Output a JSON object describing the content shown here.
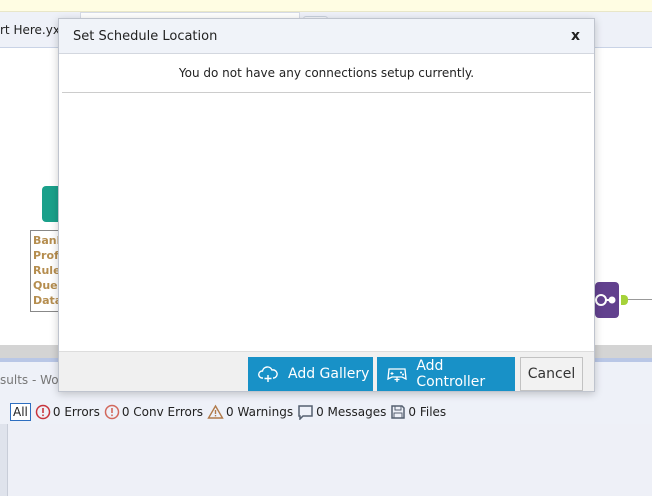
{
  "window": {
    "tab_label": "rt Here.yxm"
  },
  "canvas": {
    "annotation_lines": [
      "Bank",
      "Profi",
      "Rules",
      "Query",
      "Data"
    ]
  },
  "results": {
    "header": "sults - Workf",
    "filters": [
      {
        "label": "All"
      },
      {
        "label": "0 Errors",
        "icon": "error-icon"
      },
      {
        "label": "0 Conv Errors",
        "icon": "conv-error-icon"
      },
      {
        "label": "0 Warnings",
        "icon": "warning-icon"
      },
      {
        "label": "0 Messages",
        "icon": "message-icon"
      },
      {
        "label": "0 Files",
        "icon": "file-icon"
      }
    ]
  },
  "dialog": {
    "title": "Set Schedule Location",
    "close": "x",
    "message": "You do not have any connections setup currently.",
    "buttons": {
      "add_gallery": "Add Gallery",
      "add_controller": "Add Controller",
      "cancel": "Cancel"
    }
  },
  "colors": {
    "accent": "#1891c7",
    "tool_teal": "#1aa08a",
    "tool_purple": "#62418e"
  }
}
